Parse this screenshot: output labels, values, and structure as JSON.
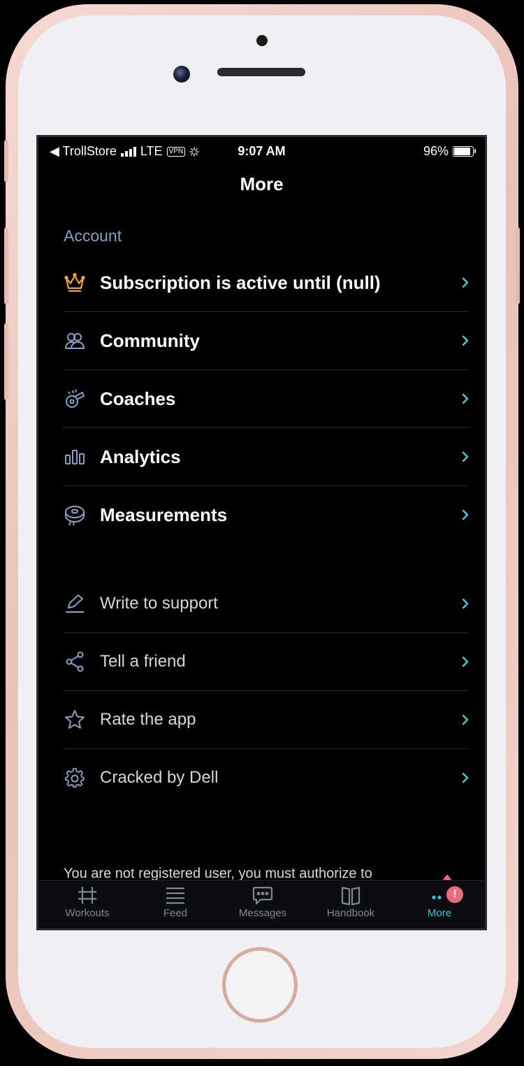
{
  "status_bar": {
    "carrier": "◀ TrollStore",
    "network": "LTE",
    "vpn": "VPN",
    "time": "9:07 AM",
    "battery_percent": "96%",
    "battery_level": 0.96
  },
  "header": {
    "title": "More"
  },
  "account": {
    "section_label": "Account",
    "items": [
      {
        "label": "Subscription is active until (null)",
        "icon": "crown-icon",
        "icon_color": "#f0a44a"
      },
      {
        "label": "Community",
        "icon": "people-icon"
      },
      {
        "label": "Coaches",
        "icon": "whistle-icon"
      },
      {
        "label": "Analytics",
        "icon": "bar-chart-icon"
      },
      {
        "label": "Measurements",
        "icon": "tape-measure-icon"
      }
    ]
  },
  "support": {
    "items": [
      {
        "label": "Write to support",
        "icon": "pen-icon"
      },
      {
        "label": "Tell a friend",
        "icon": "share-icon"
      },
      {
        "label": "Rate the app",
        "icon": "star-icon"
      },
      {
        "label": "Cracked by Dell",
        "icon": "gear-icon"
      }
    ]
  },
  "footer_note": "You are not registered user, you must authorize to",
  "tab_bar": {
    "tabs": [
      {
        "label": "Workouts",
        "icon": "dumbbell-icon"
      },
      {
        "label": "Feed",
        "icon": "feed-icon"
      },
      {
        "label": "Messages",
        "icon": "chat-icon"
      },
      {
        "label": "Handbook",
        "icon": "book-icon"
      },
      {
        "label": "More",
        "icon": "more-dots-icon",
        "active": true,
        "badge": "!"
      }
    ]
  },
  "colors": {
    "accent": "#3fc3cf",
    "section_label": "#8aa0c4",
    "badge": "#f06b7a",
    "background": "#000000"
  }
}
